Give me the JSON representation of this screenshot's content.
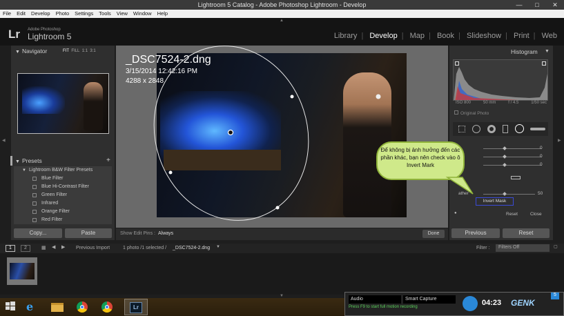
{
  "window": {
    "title": "Lightroom 5 Catalog - Adobe Photoshop Lightroom - Develop",
    "minimize": "—",
    "maximize": "□",
    "close": "✕"
  },
  "menu": [
    "File",
    "Edit",
    "Develop",
    "Photo",
    "Settings",
    "Tools",
    "View",
    "Window",
    "Help"
  ],
  "identity": {
    "logo": "Lr",
    "adobe": "Adobe Photoshop",
    "product": "Lightroom 5"
  },
  "modules": [
    "Library",
    "Develop",
    "Map",
    "Book",
    "Slideshow",
    "Print",
    "Web"
  ],
  "active_module": "Develop",
  "navigator": {
    "title": "Navigator",
    "options": [
      "FIT",
      "FILL",
      "1:1",
      "3:1"
    ],
    "active": "FIT"
  },
  "presets": {
    "title": "Presets",
    "add": "+",
    "folder": "Lightroom B&W Filter Presets",
    "items": [
      "Blue Filter",
      "Blue Hi-Contrast Filter",
      "Green Filter",
      "Infrared",
      "Orange Filter",
      "Red Filter"
    ]
  },
  "left_buttons": {
    "copy": "Copy...",
    "paste": "Paste"
  },
  "photo_info": {
    "filename": "_DSC7524-2.dng",
    "date": "3/15/2014 12:42:16 PM",
    "dims": "4288 x 2848"
  },
  "toolbar": {
    "show_edit_pins": "Show Edit Pins :",
    "pins_value": "Always",
    "done": "Done"
  },
  "histogram": {
    "title": "Histogram",
    "iso": "ISO 800",
    "focal": "50 mm",
    "aperture": "f / 4.5",
    "shutter": "1/50 sec",
    "original": "Original Photo"
  },
  "callout": "Để không bị ảnh hưởng đến các phần khác, bạn nên check vào ô Invert Mark",
  "right_panel": {
    "values": [
      "0",
      "0",
      "0",
      "0"
    ],
    "feather_label": "ather",
    "feather_value": "50",
    "invert_mask": "Invert Mask",
    "reset": "Reset",
    "close": "Close",
    "previous": "Previous",
    "reset_big": "Reset"
  },
  "filmstrip": {
    "view1": "1",
    "view2": "2",
    "source": "Previous Import",
    "count": "1 photo /1 selected /",
    "file": "_DSC7524-2.dng",
    "filter_label": "Filter :",
    "filter_value": "Filters Off"
  },
  "recorder": {
    "audio": "Audio",
    "smart": "Smart Capture",
    "hint": "Press F9 to start full motion recording",
    "time": "04:23",
    "brand": "GENK"
  }
}
